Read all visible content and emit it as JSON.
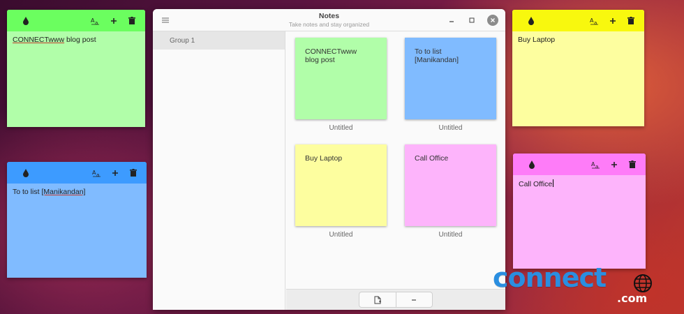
{
  "window": {
    "title": "Notes",
    "subtitle": "Take notes and stay organized",
    "sidebar": {
      "groups": [
        "Group 1"
      ]
    },
    "notes": [
      {
        "text_line1": "CONNECTwww",
        "text_line2": "blog post",
        "caption": "Untitled",
        "color": "#b1fea9"
      },
      {
        "text_line1": "To to list",
        "text_line2": "[Manikandan]",
        "caption": "Untitled",
        "color": "#80bbff"
      },
      {
        "text_line1": "Buy Laptop",
        "text_line2": "",
        "caption": "Untitled",
        "color": "#fdfe9f"
      },
      {
        "text_line1": "Call Office",
        "text_line2": "",
        "caption": "Untitled",
        "color": "#fdb4fb"
      }
    ]
  },
  "desktop_notes": {
    "green": {
      "word1": "CONNECTwww",
      "word2": " blog post",
      "bar_color": "#6bfe5f",
      "body_color": "#b1fea9"
    },
    "blue": {
      "word1": "To to list ",
      "word2": "[Manikandan]",
      "bar_color": "#3d9bff",
      "body_color": "#80bbff"
    },
    "yellow": {
      "text": "Buy Laptop",
      "bar_color": "#f8f80e",
      "body_color": "#fdfe9f"
    },
    "pink": {
      "text": "Call Office",
      "bar_color": "#fe7cf8",
      "body_color": "#fdb4fb"
    }
  },
  "icons": {
    "sticky_bar": [
      "color-drop-icon",
      "font-icon",
      "plus-icon",
      "trash-icon"
    ],
    "titlebar": [
      "menu-icon",
      "minimize-icon",
      "maximize-icon",
      "close-icon"
    ],
    "bottombar": [
      "new-note-icon",
      "minus-icon"
    ]
  },
  "logo": {
    "word": "connect",
    "suffix": ".com"
  }
}
